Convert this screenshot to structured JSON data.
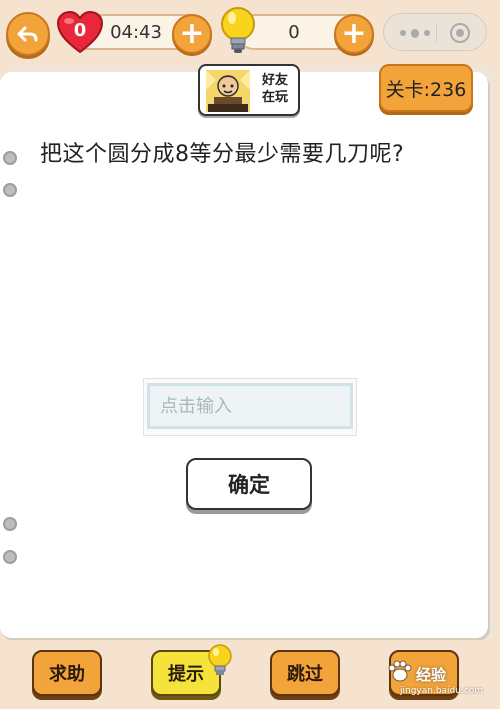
{
  "header": {
    "lives_count": "0",
    "timer": "04:43",
    "hint_count": "0",
    "plus_symbol": "+"
  },
  "friends_badge": {
    "line1": "好友",
    "line2": "在玩"
  },
  "level": {
    "label": "关卡:236"
  },
  "question": {
    "text": "把这个圆分成8等分最少需要几刀呢?"
  },
  "answer": {
    "placeholder": "点击输入",
    "value": ""
  },
  "confirm_label": "确定",
  "footer": {
    "help_label": "求助",
    "hint_label": "提示",
    "skip_label": "跳过"
  },
  "watermark": {
    "text": "经验",
    "url": "jingyan.baidu.com"
  },
  "colors": {
    "accent_orange": "#f2a33a",
    "hint_yellow": "#f5e23a",
    "background": "#f6e3cf",
    "heart_red": "#e8283a"
  },
  "icons": [
    "back-arrow-icon",
    "heart-icon",
    "plus-icon",
    "lightbulb-icon",
    "more-dots-icon",
    "close-target-icon",
    "friend-avatar-icon",
    "paw-icon"
  ]
}
